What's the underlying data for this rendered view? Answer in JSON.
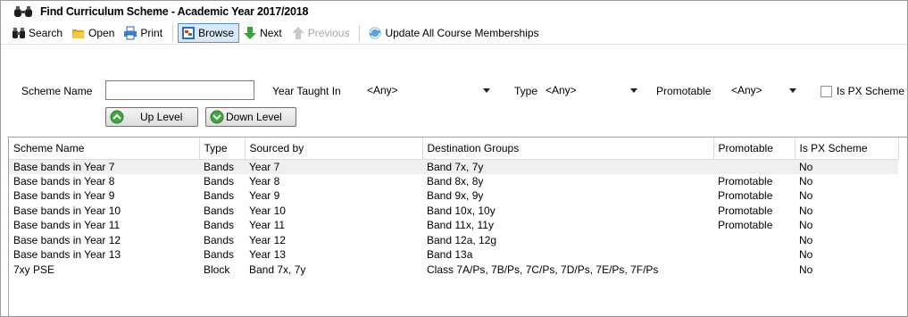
{
  "window": {
    "title": "Find Curriculum Scheme - Academic Year 2017/2018"
  },
  "toolbar": {
    "search_label": "Search",
    "open_label": "Open",
    "print_label": "Print",
    "browse_label": "Browse",
    "next_label": "Next",
    "previous_label": "Previous",
    "update_label": "Update All Course Memberships"
  },
  "filters": {
    "scheme_name_label": "Scheme Name",
    "scheme_name_value": "",
    "year_taught_label": "Year Taught In",
    "year_taught_value": "<Any>",
    "type_label": "Type",
    "type_value": "<Any>",
    "promotable_label": "Promotable",
    "promotable_value": "<Any>",
    "is_px_label": "Is PX Scheme",
    "up_level_label": "Up Level",
    "down_level_label": "Down Level"
  },
  "grid": {
    "columns": [
      "Scheme Name",
      "Type",
      "Sourced by",
      "Destination Groups",
      "Promotable",
      "Is PX Scheme"
    ],
    "rows": [
      [
        "Base bands in Year 7",
        "Bands",
        "Year  7",
        "Band 7x, 7y",
        "",
        "No"
      ],
      [
        "Base bands in Year 8",
        "Bands",
        "Year  8",
        "Band 8x, 8y",
        "Promotable",
        "No"
      ],
      [
        "Base bands in Year 9",
        "Bands",
        "Year  9",
        "Band 9x, 9y",
        "Promotable",
        "No"
      ],
      [
        "Base bands in Year 10",
        "Bands",
        "Year 10",
        "Band 10x, 10y",
        "Promotable",
        "No"
      ],
      [
        "Base bands in Year 11",
        "Bands",
        "Year 11",
        "Band 11x, 11y",
        "Promotable",
        "No"
      ],
      [
        "Base bands in Year 12",
        "Bands",
        "Year 12",
        "Band 12a, 12g",
        "",
        "No"
      ],
      [
        "Base bands in Year 13",
        "Bands",
        "Year 13",
        "Band 13a",
        "",
        "No"
      ],
      [
        "7xy PSE",
        "Block",
        "Band 7x, 7y",
        "Class 7A/Ps, 7B/Ps, 7C/Ps, 7D/Ps, 7E/Ps, 7F/Ps",
        "",
        "No"
      ]
    ]
  },
  "colors": {
    "selected_row": "#efefef",
    "active_button_bg": "#d9e8f8",
    "active_button_border": "#5b8fc7"
  }
}
